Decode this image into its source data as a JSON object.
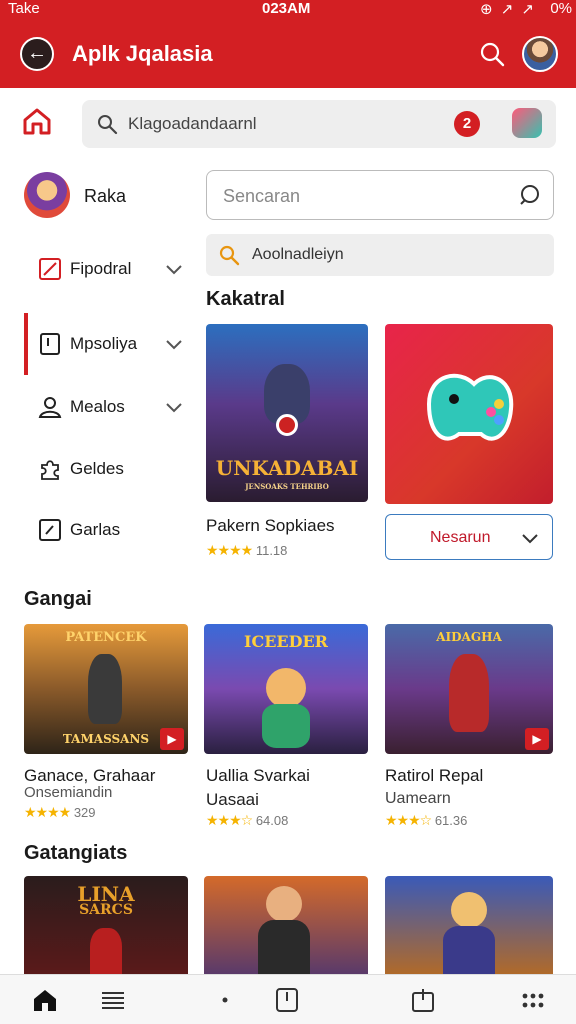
{
  "status": {
    "carrier": "Take",
    "time": "023AM",
    "icons": "⊕ ↗ ↗",
    "battery": "0%"
  },
  "app": {
    "title": "Aplk Jqalasia"
  },
  "search": {
    "placeholder": "Klagoadandaarnl",
    "badge": "2"
  },
  "sidebar": {
    "user": "Raka",
    "items": [
      {
        "label": "Fipodral",
        "icon": "edit-square-icon",
        "has_chevron": true
      },
      {
        "label": "Mpsoliya",
        "icon": "bookmark-icon",
        "has_chevron": true
      },
      {
        "label": "Mealos",
        "icon": "user-icon",
        "has_chevron": true
      },
      {
        "label": "Geldes",
        "icon": "puzzle-icon",
        "has_chevron": false
      },
      {
        "label": "Garlas",
        "icon": "edit-small-icon",
        "has_chevron": false
      }
    ]
  },
  "main": {
    "search_box_placeholder": "Sencaran",
    "search_filter_text": "Aoolnadleiyn",
    "section_title": "Kakatral",
    "featured": {
      "poster_title": "UNKADABAI",
      "poster_sub": "JENSOAKS TEHRIBO",
      "title": "Pakern Sopkiaes",
      "stars": "★★★★",
      "rating": "11.18"
    },
    "promo_button": "Nesarun"
  },
  "section2": {
    "title": "Gangai",
    "cards": [
      {
        "poster_top": "PATENCEK",
        "poster_bottom": "TAMASSANS",
        "title": "Ganace, Grahaar",
        "sub": "Onsemiandin",
        "stars": "★★★★",
        "rating": "329"
      },
      {
        "poster_top": "ICEEDER",
        "poster_bottom": "",
        "title": "Uallia Svarkai",
        "sub": "Uasaai",
        "stars": "★★★☆",
        "rating": "64.08"
      },
      {
        "poster_top": "AIDAGHA",
        "poster_bottom": "",
        "title": "Ratirol Repal",
        "sub": "Uamearn",
        "stars": "★★★☆",
        "rating": "61.36"
      }
    ]
  },
  "section3": {
    "title": "Gatangiats",
    "cards": [
      {
        "poster_top": "LINA",
        "poster_bottom": "SARCS"
      },
      {
        "poster_top": "",
        "poster_bottom": ""
      },
      {
        "poster_top": "",
        "poster_bottom": ""
      }
    ]
  },
  "colors": {
    "brand_red": "#d31f23",
    "star": "#f5b301",
    "accent_blue": "#3b7bbf"
  }
}
